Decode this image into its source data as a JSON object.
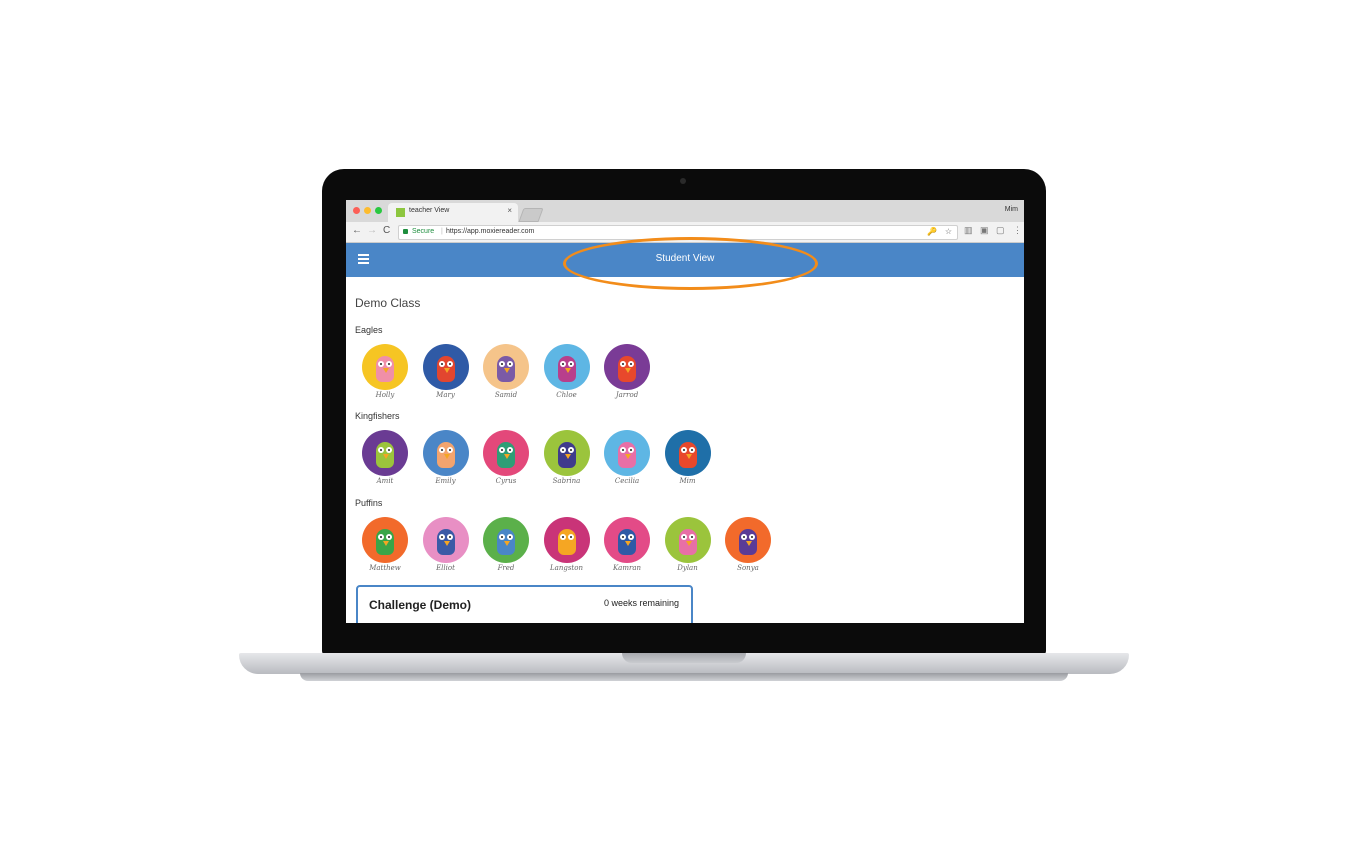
{
  "browser": {
    "tab_title": "teacher View",
    "tab_close": "×",
    "user_name": "Mim",
    "secure_label": "Secure",
    "url": "https://app.moxiereader.com",
    "back": "←",
    "forward": "→",
    "reload": "C",
    "key_icon": "🔑",
    "star_icon": "☆",
    "menu_icon": "⋮"
  },
  "app": {
    "title": "Student View",
    "class_name": "Demo Class"
  },
  "groups": [
    {
      "name": "Eagles",
      "students": [
        {
          "name": "Holly",
          "bg": "#f6c523",
          "body": "#f08fa8"
        },
        {
          "name": "Mary",
          "bg": "#2f5aa6",
          "body": "#e2462f"
        },
        {
          "name": "Samid",
          "bg": "#f5c48a",
          "body": "#7b5aa6"
        },
        {
          "name": "Chloe",
          "bg": "#5eb6e4",
          "body": "#b83f8c"
        },
        {
          "name": "Jarrod",
          "bg": "#7a3b96",
          "body": "#e8482c"
        }
      ]
    },
    {
      "name": "Kingfishers",
      "students": [
        {
          "name": "Amit",
          "bg": "#6a3b93",
          "body": "#9bc43c"
        },
        {
          "name": "Emily",
          "bg": "#4a86c7",
          "body": "#f3a46e"
        },
        {
          "name": "Cyrus",
          "bg": "#e3487a",
          "body": "#2f9e76"
        },
        {
          "name": "Sabrina",
          "bg": "#9bc43c",
          "body": "#3f3b8c"
        },
        {
          "name": "Cecilia",
          "bg": "#5eb6e4",
          "body": "#e86fa6"
        },
        {
          "name": "Mim",
          "bg": "#1f6fa8",
          "body": "#e8482c"
        }
      ]
    },
    {
      "name": "Puffins",
      "students": [
        {
          "name": "Matthew",
          "bg": "#f26a2b",
          "body": "#3aa548"
        },
        {
          "name": "Elliot",
          "bg": "#e88fc4",
          "body": "#3b5aa6"
        },
        {
          "name": "Fred",
          "bg": "#5bb04a",
          "body": "#4a86c7"
        },
        {
          "name": "Langston",
          "bg": "#c93478",
          "body": "#f5a623"
        },
        {
          "name": "Kamran",
          "bg": "#e34b87",
          "body": "#2f5aa6"
        },
        {
          "name": "Dylan",
          "bg": "#9bc43c",
          "body": "#e86fa6"
        },
        {
          "name": "Sonya",
          "bg": "#f26a2b",
          "body": "#5a3b96"
        }
      ]
    }
  ],
  "challenge": {
    "title": "Challenge (Demo)",
    "remaining": "0 weeks remaining"
  },
  "colors": {
    "app_bar": "#4a86c7",
    "highlight_ring": "#f28c1a"
  }
}
